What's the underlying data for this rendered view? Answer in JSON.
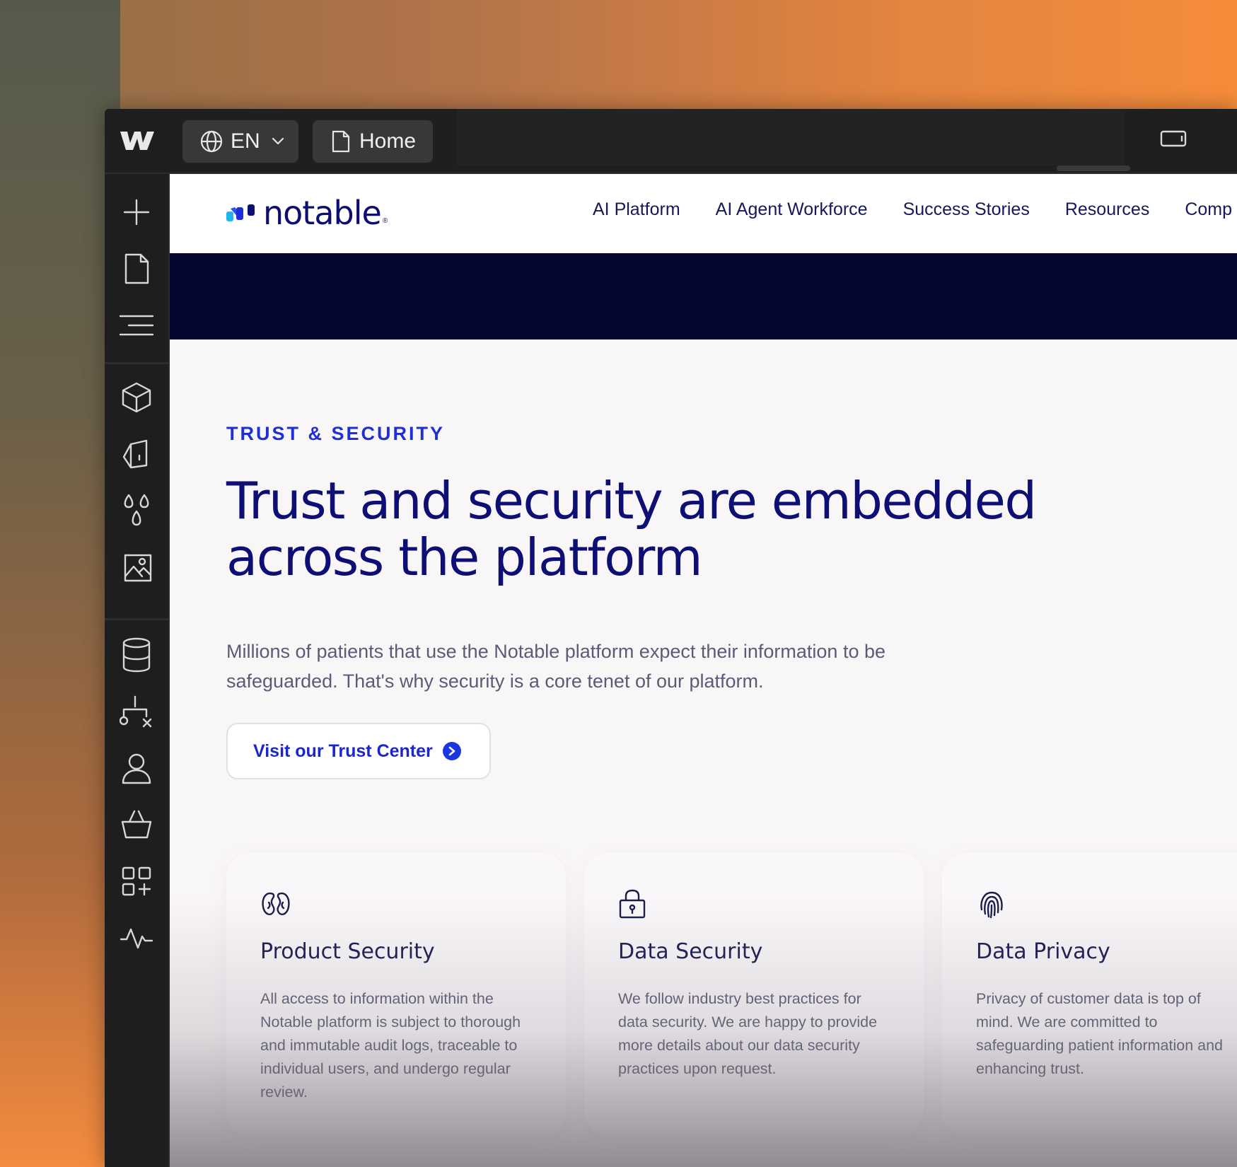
{
  "toolbar": {
    "locale_label": "EN",
    "page_label": "Home"
  },
  "site": {
    "logo_text": "notable",
    "logo_mark": "®",
    "nav": [
      "AI Platform",
      "AI Agent Workforce",
      "Success Stories",
      "Resources",
      "Comp"
    ]
  },
  "hero": {
    "eyebrow": "TRUST & SECURITY",
    "headline": "Trust and security are embedded across the platform",
    "lead": "Millions of patients that use the Notable platform expect their information to be safeguarded. That's why security is a core tenet of our platform.",
    "cta_label": "Visit our Trust Center"
  },
  "cards": [
    {
      "icon": "kidneys-icon",
      "title": "Product Security",
      "body": "All access to information within the Notable platform is subject to thorough and immutable audit logs, traceable to individual users, and undergo regular review."
    },
    {
      "icon": "lock-icon",
      "title": "Data Security",
      "body": "We follow industry best practices for data security. We are happy to provide more details about our data security practices upon request."
    },
    {
      "icon": "fingerprint-icon",
      "title": "Data Privacy",
      "body": "Privacy of customer data is top of mind. We are committed to safeguarding patient information and enhancing trust."
    }
  ],
  "colors": {
    "brand_navy": "#0e0f74",
    "accent_blue": "#1b35e0",
    "dark_band": "#050730"
  }
}
